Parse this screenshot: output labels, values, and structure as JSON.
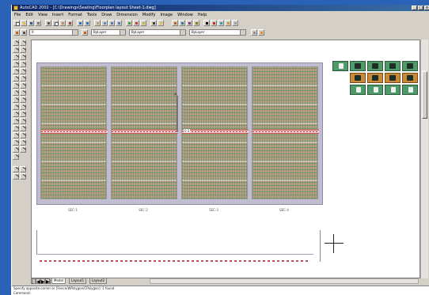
{
  "window": {
    "title": "AutoCAD 2002 - [C:\\Drawings\\Seating\\Floorplan layout Sheet-1.dwg]",
    "minimize_glyph": "_",
    "maximize_glyph": "□",
    "close_glyph": "×"
  },
  "menu": [
    "File",
    "Edit",
    "View",
    "Insert",
    "Format",
    "Tools",
    "Draw",
    "Dimension",
    "Modify",
    "Image",
    "Window",
    "Help"
  ],
  "properties_bar": {
    "layer": "0",
    "color": "ByLayer",
    "linetype": "ByLayer",
    "lineweight": "ByLayer"
  },
  "canvas": {
    "panel_labels": [
      "SEC-1",
      "SEC-2",
      "SEC-3",
      "SEC-4"
    ],
    "vertical_mark": "A",
    "dimension_label": "0.5"
  },
  "layout_tabs": {
    "nav_first": "|◀",
    "nav_prev": "◀",
    "nav_next": "▶",
    "nav_last": "▶|",
    "items": [
      "Model",
      "Layout1",
      "Layout2"
    ]
  },
  "command_line": {
    "line1": "Specify opposite corner or [Fence/WPolygon/CPolygon]: 1 found",
    "line2": "Command:"
  },
  "colors": {
    "desktop": "#2a62b8",
    "titlebar": "#0a246a",
    "panel_fill": "#b5a27a",
    "band": "#d05050",
    "thumbnail": "#4f9a6a"
  },
  "icons": [
    "app-icon",
    "new-icon",
    "open-icon",
    "save-icon",
    "print-icon",
    "zoom-icon",
    "pan-icon",
    "line-tool-icon",
    "crosshair-cursor-icon"
  ]
}
